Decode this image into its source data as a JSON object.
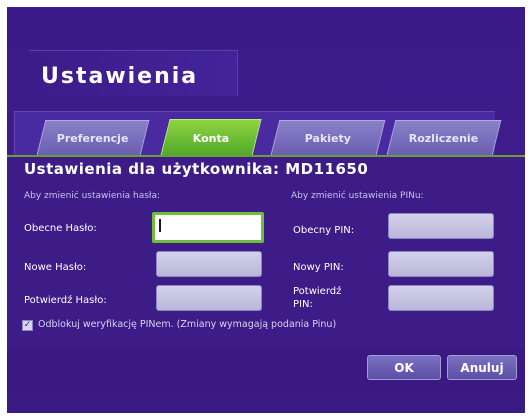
{
  "window": {
    "title": "Ustawienia"
  },
  "tabs": [
    {
      "label": "Preferencje",
      "active": false
    },
    {
      "label": "Konta",
      "active": true
    },
    {
      "label": "Pakiety",
      "active": false
    },
    {
      "label": "Rozliczenie",
      "active": false
    }
  ],
  "panel": {
    "heading": "Ustawienia dla użytkownika: MD11650",
    "password_section": {
      "label": "Aby zmienić ustawienia hasła:",
      "current_label": "Obecne Hasło:",
      "current_value": "",
      "new_label": "Nowe Hasło:",
      "new_value": "",
      "confirm_label": "Potwierdź Hasło:",
      "confirm_value": ""
    },
    "pin_section": {
      "label": "Aby zmienić ustawienia PINu:",
      "current_label": "Obecny PIN:",
      "current_value": "",
      "new_label": "Nowy PIN:",
      "new_value": "",
      "confirm_label": "Potwierdź PIN:",
      "confirm_value": ""
    },
    "checkbox": {
      "checked": true,
      "label": "Odblokuj weryfikację PINem. (Zmiany wymagają podania Pinu)"
    }
  },
  "buttons": {
    "ok": "OK",
    "cancel": "Anuluj"
  },
  "colors": {
    "background": "#3a1b87",
    "accent_active_tab": "#6fbf3b",
    "inactive_tab": "#7a70bd",
    "field": "#c8c5e3"
  }
}
